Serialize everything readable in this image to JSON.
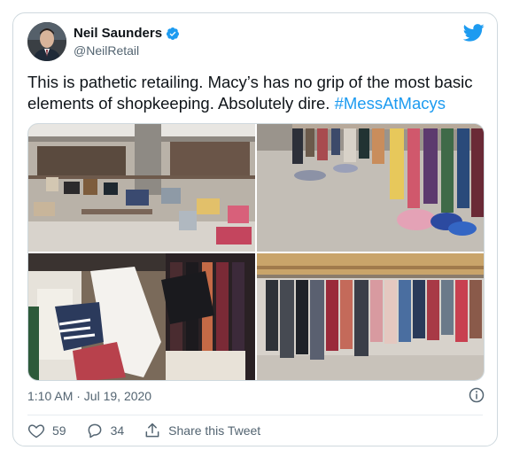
{
  "author": {
    "name": "Neil Saunders",
    "handle": "@NeilRetail"
  },
  "tweet": {
    "text": "This is pathetic retailing. Macy’s has no grip of the most basic elements of shopkeeping. Absolutely dire.",
    "hashtag": "#MessAtMacys",
    "timestamp": "1:10 AM · Jul 19, 2020"
  },
  "media": {
    "photos": [
      {
        "alt": "store-display-photo"
      },
      {
        "alt": "clothes-on-floor-photo"
      },
      {
        "alt": "messy-display-photo"
      },
      {
        "alt": "clothing-racks-photo"
      }
    ]
  },
  "actions": {
    "likes": "59",
    "replies": "34",
    "share_label": "Share this Tweet"
  },
  "colors": {
    "accent": "#1d9bf0",
    "text": "#0f1419",
    "muted": "#536471",
    "border": "#cfd9de"
  },
  "icons": [
    "verified-badge-icon",
    "twitter-bird-icon",
    "info-icon",
    "heart-icon",
    "reply-icon",
    "share-icon"
  ]
}
